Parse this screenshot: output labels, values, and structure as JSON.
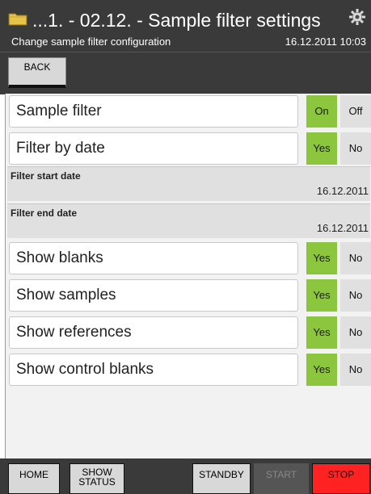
{
  "header": {
    "title": "...1. - 02.12. - Sample filter settings",
    "subtitle": "Change sample filter configuration",
    "datetime": "16.12.2011 10:03",
    "folder_icon": "folder-icon",
    "settings_icon": "gear-icon"
  },
  "toolbar": {
    "back_label": "BACK"
  },
  "rows": {
    "sample_filter": {
      "label": "Sample filter",
      "left": "On",
      "right": "Off",
      "selected": "On"
    },
    "filter_by_date": {
      "label": "Filter by date",
      "left": "Yes",
      "right": "No",
      "selected": "Yes"
    },
    "filter_start": {
      "label": "Filter start date",
      "value": "16.12.2011"
    },
    "filter_end": {
      "label": "Filter end date",
      "value": "16.12.2011"
    },
    "show_blanks": {
      "label": "Show blanks",
      "left": "Yes",
      "right": "No",
      "selected": "Yes"
    },
    "show_samples": {
      "label": "Show samples",
      "left": "Yes",
      "right": "No",
      "selected": "Yes"
    },
    "show_references": {
      "label": "Show references",
      "left": "Yes",
      "right": "No",
      "selected": "Yes"
    },
    "show_control_blanks": {
      "label": "Show control blanks",
      "left": "Yes",
      "right": "No",
      "selected": "Yes"
    }
  },
  "bottom": {
    "home": "HOME",
    "show_status_line1": "SHOW",
    "show_status_line2": "STATUS",
    "standby": "STANDBY",
    "start": "START",
    "stop": "STOP"
  },
  "colors": {
    "active": "#8cc63f",
    "stop": "#ff2222",
    "bar": "#3a3a3a"
  }
}
